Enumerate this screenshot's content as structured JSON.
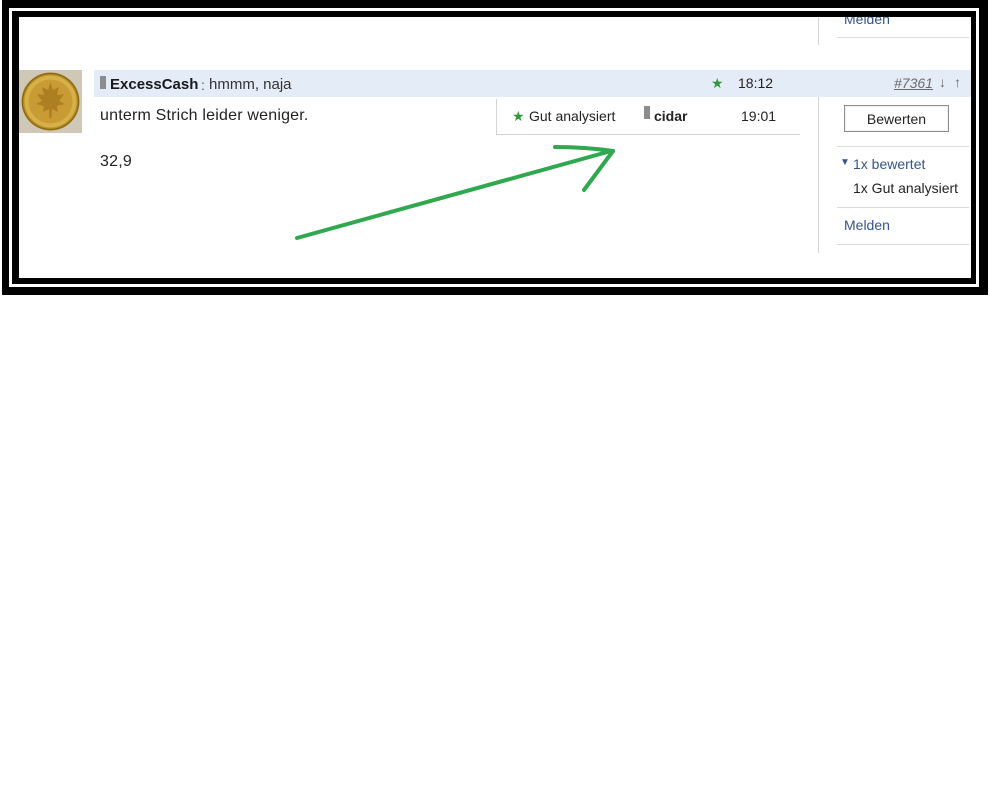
{
  "post": {
    "author": "ExcessCash",
    "separator": ":",
    "title": "hmmm, naja",
    "time": "18:12",
    "number": "#7361",
    "nav_down": "↓",
    "nav_up": "↑",
    "body_line1": "unterm Strich leider weniger.",
    "body_line2": "32,9"
  },
  "rating_popup": {
    "label": "Gut analysiert",
    "user": "cidar",
    "time": "19:01"
  },
  "sidebar": {
    "top_link": "Melden",
    "rate_button": "Bewerten",
    "rated_count": "1x bewertet",
    "rated_detail": "1x Gut analysiert",
    "report_link": "Melden"
  },
  "colors": {
    "accent_green": "#2e9b3a",
    "link_blue": "#34558b",
    "header_bg": "#e4ecf7"
  },
  "icons": {
    "rating_star": "star-icon",
    "user_pin": "user-status-icon",
    "expand": "triangle-down-icon",
    "annotation": "green-arrow-annotation"
  }
}
